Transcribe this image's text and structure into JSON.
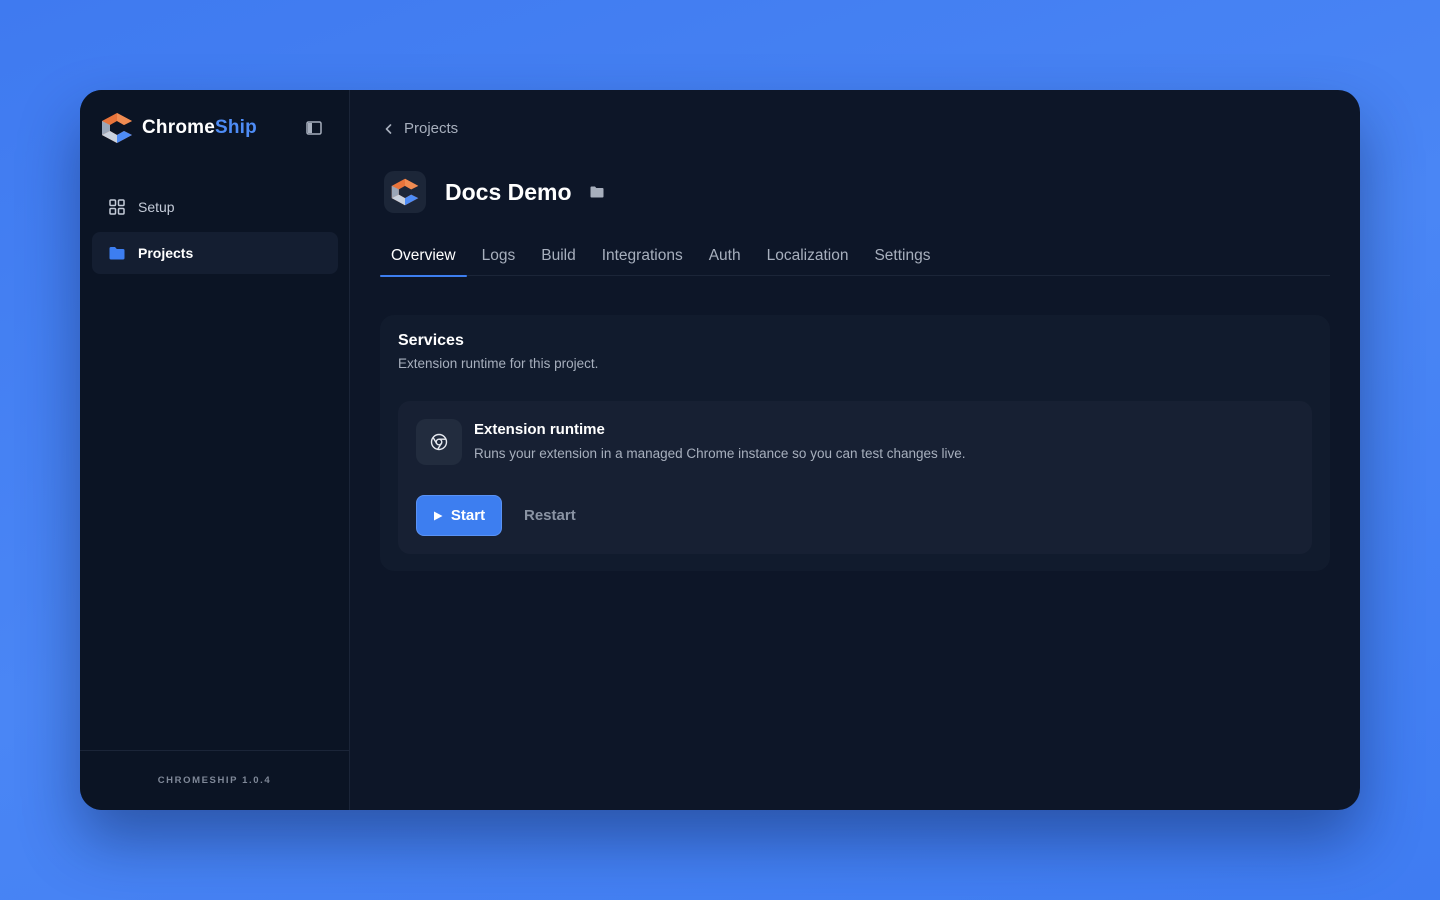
{
  "brand": {
    "name_primary": "Chrome",
    "name_accent": "Ship"
  },
  "sidebar": {
    "items": [
      {
        "label": "Setup",
        "icon": "grid-icon",
        "active": false
      },
      {
        "label": "Projects",
        "icon": "folder-icon",
        "active": true
      }
    ],
    "footer_version": "CHROMESHIP 1.0.4"
  },
  "breadcrumb": {
    "label": "Projects"
  },
  "project": {
    "title": "Docs Demo"
  },
  "tabs": [
    {
      "label": "Overview",
      "active": true
    },
    {
      "label": "Logs",
      "active": false
    },
    {
      "label": "Build",
      "active": false
    },
    {
      "label": "Integrations",
      "active": false
    },
    {
      "label": "Auth",
      "active": false
    },
    {
      "label": "Localization",
      "active": false
    },
    {
      "label": "Settings",
      "active": false
    }
  ],
  "services": {
    "title": "Services",
    "subtitle": "Extension runtime for this project.",
    "runtime": {
      "title": "Extension runtime",
      "description": "Runs your extension in a managed Chrome instance so you can test changes live.",
      "start_label": "Start",
      "restart_label": "Restart"
    }
  },
  "colors": {
    "accent": "#3d7ef0",
    "background_gradient": "#4a86f5",
    "window_bg": "#0d1628",
    "sidebar_bg": "#0b1424"
  }
}
